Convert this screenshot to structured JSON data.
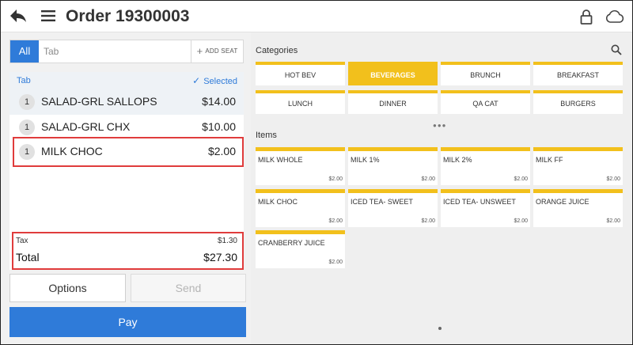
{
  "header": {
    "title": "Order 19300003"
  },
  "tab_bar": {
    "all_label": "All",
    "tab_placeholder": "Tab",
    "add_seat_label": "ADD SEAT"
  },
  "order": {
    "tab_label": "Tab",
    "selected_label": "Selected",
    "items": [
      {
        "qty": "1",
        "name": "SALAD-GRL SALLOPS",
        "price": "$14.00"
      },
      {
        "qty": "1",
        "name": "SALAD-GRL CHX",
        "price": "$10.00"
      },
      {
        "qty": "1",
        "name": "MILK CHOC",
        "price": "$2.00"
      }
    ]
  },
  "totals": {
    "tax_label": "Tax",
    "tax_value": "$1.30",
    "total_label": "Total",
    "total_value": "$27.30"
  },
  "actions": {
    "options_label": "Options",
    "send_label": "Send",
    "pay_label": "Pay"
  },
  "categories_section": {
    "label": "Categories",
    "selected": "BEVERAGES",
    "items": [
      "HOT BEV",
      "BEVERAGES",
      "BRUNCH",
      "BREAKFAST",
      "LUNCH",
      "DINNER",
      "QA CAT",
      "BURGERS"
    ]
  },
  "items_section": {
    "label": "Items",
    "items": [
      {
        "name": "MILK WHOLE",
        "price": "$2.00"
      },
      {
        "name": "MILK 1%",
        "price": "$2.00"
      },
      {
        "name": "MILK 2%",
        "price": "$2.00"
      },
      {
        "name": "MILK FF",
        "price": "$2.00"
      },
      {
        "name": "MILK CHOC",
        "price": "$2.00"
      },
      {
        "name": "ICED TEA- SWEET",
        "price": "$2.00"
      },
      {
        "name": "ICED TEA- UNSWEET",
        "price": "$2.00"
      },
      {
        "name": "ORANGE JUICE",
        "price": "$2.00"
      },
      {
        "name": "CRANBERRY JUICE",
        "price": "$2.00"
      }
    ]
  },
  "colors": {
    "primary_blue": "#2f7bd9",
    "category_yellow": "#f2c01c",
    "highlight_red": "#e03c3c"
  },
  "icons": [
    "back-arrow-icon",
    "hamburger-menu-icon",
    "lock-icon",
    "cloud-icon",
    "search-icon",
    "plus-icon",
    "checkmark-icon"
  ]
}
